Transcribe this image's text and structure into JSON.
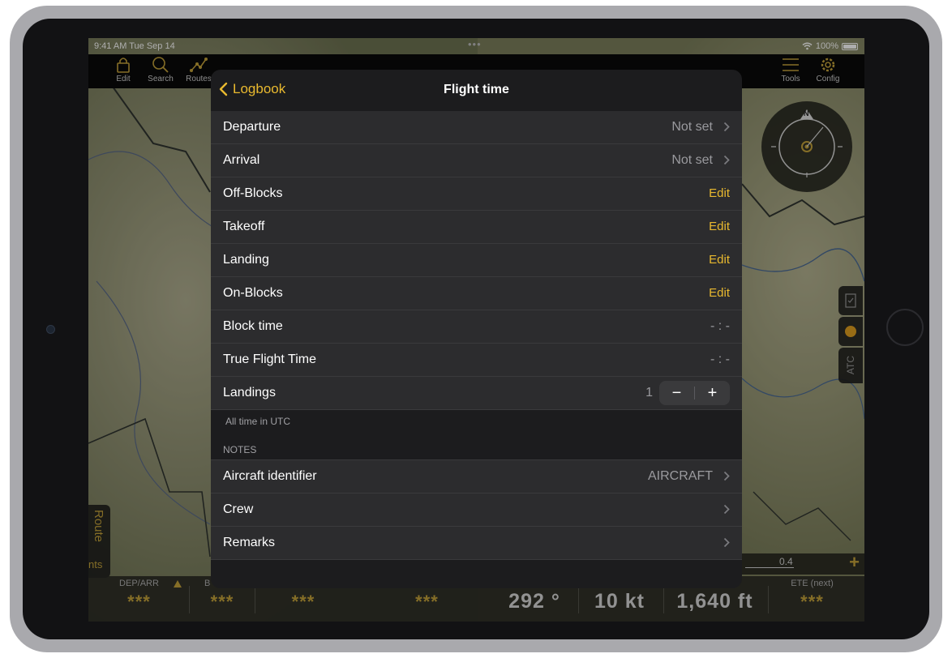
{
  "status": {
    "time": "9:41 AM  Tue Sep 14",
    "dots": "•••",
    "battery": "100%"
  },
  "toolbar": {
    "edit": "Edit",
    "search": "Search",
    "routes": "Routes",
    "tools": "Tools",
    "config": "Config"
  },
  "nav": {
    "back_label": "Logbook",
    "title": "Flight time"
  },
  "rows": {
    "departure": {
      "label": "Departure",
      "value": "Not set"
    },
    "arrival": {
      "label": "Arrival",
      "value": "Not set"
    },
    "off_blocks": {
      "label": "Off-Blocks",
      "action": "Edit"
    },
    "takeoff": {
      "label": "Takeoff",
      "action": "Edit"
    },
    "landing": {
      "label": "Landing",
      "action": "Edit"
    },
    "on_blocks": {
      "label": "On-Blocks",
      "action": "Edit"
    },
    "block_time": {
      "label": "Block time",
      "value": "- : -"
    },
    "true_flight_time": {
      "label": "True Flight Time",
      "value": "- : -"
    },
    "landings": {
      "label": "Landings",
      "value": "1",
      "minus": "−",
      "plus": "+"
    }
  },
  "footer_note": "All time in UTC",
  "notes": {
    "header": "NOTES",
    "aircraft": {
      "label": "Aircraft identifier",
      "value": "AIRCRAFT"
    },
    "crew": {
      "label": "Crew"
    },
    "remarks": {
      "label": "Remarks"
    }
  },
  "map": {
    "compass_north": "N",
    "side_atc": "ATC",
    "route_tab": "Route",
    "route_tab_partial": "nts",
    "scale_value": "0.4",
    "scale_plus": "+"
  },
  "instruments": [
    {
      "label": "DEP/ARR",
      "value": "***"
    },
    {
      "label": "B",
      "value": "***"
    },
    {
      "label": "",
      "value": "***"
    },
    {
      "label": "",
      "value": "***"
    },
    {
      "label": "",
      "value": "292 °"
    },
    {
      "label": "",
      "value": "10 kt"
    },
    {
      "label": "",
      "value": "1,640 ft"
    },
    {
      "label": "ETE (next)",
      "value": "***"
    }
  ],
  "colors": {
    "accent": "#e9b92f",
    "map_accent": "#c4a23a",
    "panel": "#1c1c1e",
    "row": "#2c2c2e"
  }
}
